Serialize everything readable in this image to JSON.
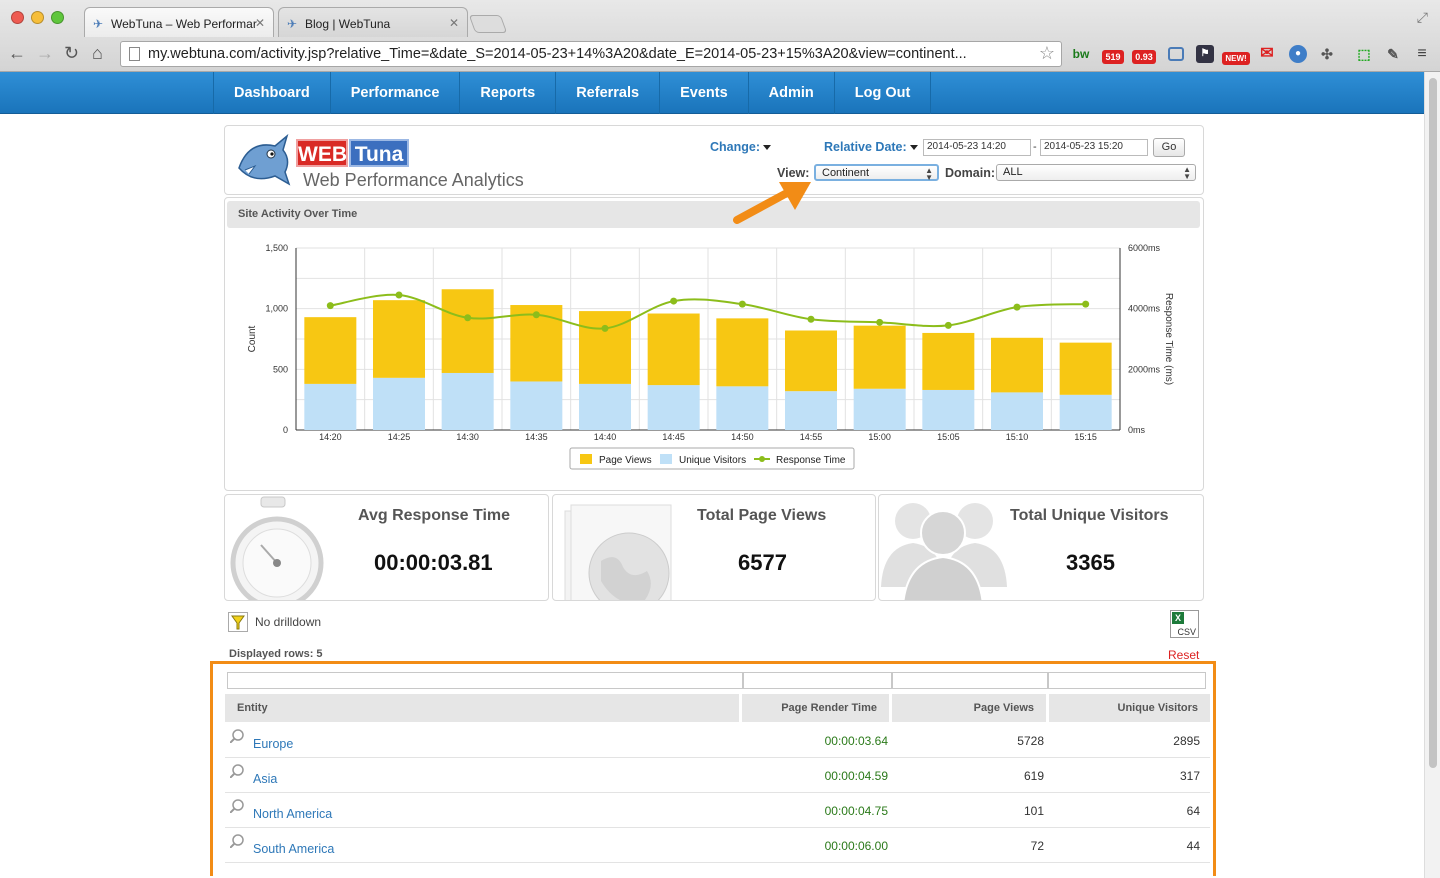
{
  "browser": {
    "tabs": [
      {
        "title": "WebTuna – Web Performar"
      },
      {
        "title": "Blog | WebTuna"
      }
    ],
    "url": "my.webtuna.com/activity.jsp?relative_Time=&date_S=2014-05-23+14%3A20&date_E=2014-05-23+15%3A20&view=continent...",
    "ext_badges": {
      "b1": "519",
      "b2": "0.93",
      "b3": "NEW!"
    }
  },
  "nav": {
    "items": [
      "Dashboard",
      "Performance",
      "Reports",
      "Referrals",
      "Events",
      "Admin",
      "Log Out"
    ]
  },
  "header": {
    "logo_web": "WEB",
    "logo_tuna": "Tuna",
    "logo_sub": "Web Performance Analytics",
    "change_label": "Change:",
    "relative_date_label": "Relative Date:",
    "date_start": "2014-05-23 14:20",
    "date_sep": "-",
    "date_end": "2014-05-23 15:20",
    "go_label": "Go",
    "view_label": "View:",
    "view_value": "Continent",
    "domain_label": "Domain:",
    "domain_value": "ALL"
  },
  "chart_section": {
    "title": "Site Activity Over Time"
  },
  "chart_data": {
    "type": "bar",
    "categories": [
      "14:20",
      "14:25",
      "14:30",
      "14:35",
      "14:40",
      "14:45",
      "14:50",
      "14:55",
      "15:00",
      "15:05",
      "15:10",
      "15:15"
    ],
    "series": [
      {
        "name": "Unique Visitors",
        "values": [
          380,
          430,
          470,
          400,
          380,
          370,
          360,
          320,
          340,
          330,
          310,
          290
        ],
        "color": "#bfe0f7"
      },
      {
        "name": "Page Views",
        "values": [
          550,
          640,
          690,
          630,
          600,
          590,
          560,
          500,
          520,
          470,
          450,
          430
        ],
        "color": "#f7c713"
      },
      {
        "name": "Response Time",
        "type": "line",
        "axis": "right",
        "values": [
          4100,
          4450,
          3700,
          3800,
          3350,
          4250,
          4150,
          3650,
          3550,
          3450,
          4050,
          4150
        ],
        "color": "#8cbd1b"
      }
    ],
    "stacked": true,
    "ylabel": "Count",
    "ylabel_right": "Response Time (ms)",
    "ylim": [
      0,
      1500
    ],
    "ylim_right": [
      0,
      6000
    ],
    "yticks": [
      "0",
      "500",
      "1,000",
      "1,500"
    ],
    "yticks_right": [
      "0ms",
      "2000ms",
      "4000ms",
      "6000ms"
    ],
    "legend": [
      "Page Views",
      "Unique Visitors",
      "Response Time"
    ],
    "legend_position": "bottom",
    "grid": true
  },
  "stats": {
    "avg_title": "Avg Response Time",
    "avg_value": "00:00:03.81",
    "pv_title": "Total Page Views",
    "pv_value": "6577",
    "uv_title": "Total Unique Visitors",
    "uv_value": "3365"
  },
  "drilldown": {
    "text": "No drilldown"
  },
  "table": {
    "displayed_rows": "Displayed rows: 5",
    "reset": "Reset",
    "csv": "CSV",
    "columns": [
      "Entity",
      "Page Render Time",
      "Page Views",
      "Unique Visitors"
    ],
    "rows": [
      {
        "entity": "Europe",
        "render": "00:00:03.64",
        "views": "5728",
        "visitors": "2895"
      },
      {
        "entity": "Asia",
        "render": "00:00:04.59",
        "views": "619",
        "visitors": "317"
      },
      {
        "entity": "North America",
        "render": "00:00:04.75",
        "views": "101",
        "visitors": "64"
      },
      {
        "entity": "South America",
        "render": "00:00:06.00",
        "views": "72",
        "visitors": "44"
      }
    ]
  },
  "colors": {
    "nav": "#1f7fc8",
    "highlight": "#f28c16",
    "link": "#2e78b8",
    "render_time": "#2b7a1a"
  }
}
